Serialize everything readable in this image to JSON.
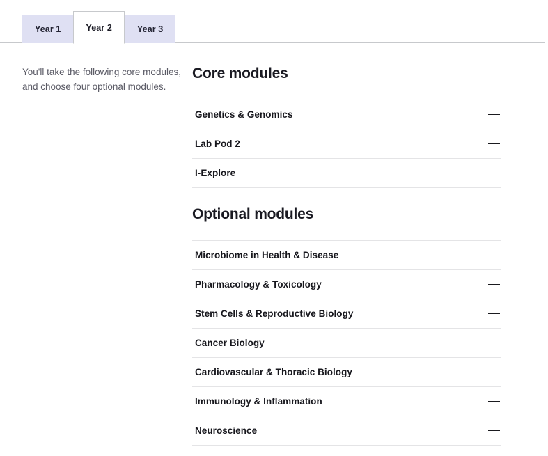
{
  "tabs": [
    {
      "label": "Year 1",
      "active": false
    },
    {
      "label": "Year 2",
      "active": true
    },
    {
      "label": "Year 3",
      "active": false
    }
  ],
  "intro": {
    "text": "You'll take the following core modules, and choose four optional modules."
  },
  "sections": [
    {
      "title": "Core modules",
      "items": [
        {
          "label": "Genetics & Genomics",
          "icon": "plus-icon"
        },
        {
          "label": "Lab Pod 2",
          "icon": "plus-icon"
        },
        {
          "label": "I-Explore",
          "icon": "plus-icon"
        }
      ]
    },
    {
      "title": "Optional modules",
      "items": [
        {
          "label": "Microbiome in Health & Disease",
          "icon": "plus-icon"
        },
        {
          "label": "Pharmacology & Toxicology",
          "icon": "plus-icon"
        },
        {
          "label": "Stem Cells & Reproductive Biology",
          "icon": "plus-icon"
        },
        {
          "label": "Cancer Biology",
          "icon": "plus-icon"
        },
        {
          "label": "Cardiovascular & Thoracic Biology",
          "icon": "plus-icon"
        },
        {
          "label": "Immunology & Inflammation",
          "icon": "plus-icon"
        },
        {
          "label": "Neuroscience",
          "icon": "plus-icon"
        }
      ]
    }
  ],
  "colors": {
    "tab_inactive_bg": "#dfe0f3",
    "tab_active_bg": "#ffffff",
    "tab_text": "#232333",
    "border": "#c7c9cc",
    "divider": "#e4e4e6",
    "heading": "#1a1a22",
    "body_text": "#5b5b66"
  }
}
